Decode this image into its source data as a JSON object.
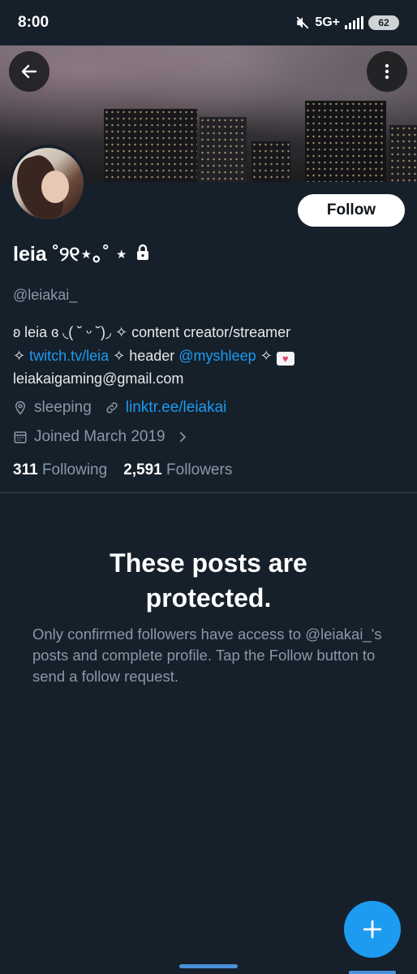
{
  "status_bar": {
    "time": "8:00",
    "network": "5G+",
    "battery": "62",
    "icons": [
      "mute-icon",
      "signal-icon",
      "battery-icon"
    ]
  },
  "header": {
    "back_icon": "back-arrow-icon",
    "more_icon": "more-vertical-icon"
  },
  "profile": {
    "name": "leia ˚୨୧⋆｡˚ ⋆",
    "lock_icon": "lock-icon",
    "handle": "@leiakai_",
    "follow_label": "Follow",
    "bio": {
      "line1": "ʚ leia ɞ ◟( ˘ ᵕ ˘)◞ ✧ content creator/streamer",
      "line2_prefix": "✧ ",
      "line2_link1": "twitch.tv/leia",
      "line2_mid": " ✧ header ",
      "line2_link2": "@myshleep",
      "line2_suffix": " ✧ ",
      "heart_icon": "heart-letter-icon",
      "line3": "leiakaigaming@gmail.com"
    },
    "location": "sleeping",
    "website": "linktr.ee/leiakai",
    "joined": "Joined March 2019",
    "following_count": "311",
    "following_label": "Following",
    "followers_count": "2,591",
    "followers_label": "Followers"
  },
  "protected": {
    "title_line1": "These posts are",
    "title_line2": "protected.",
    "body": "Only confirmed followers have access to @leiakai_'s posts and complete profile. Tap the Follow button to send a follow request."
  },
  "fab": {
    "icon": "plus-icon"
  },
  "colors": {
    "background": "#15202b",
    "accent": "#1d9bf0",
    "secondary_text": "#8b98a5",
    "divider": "#38444d"
  }
}
